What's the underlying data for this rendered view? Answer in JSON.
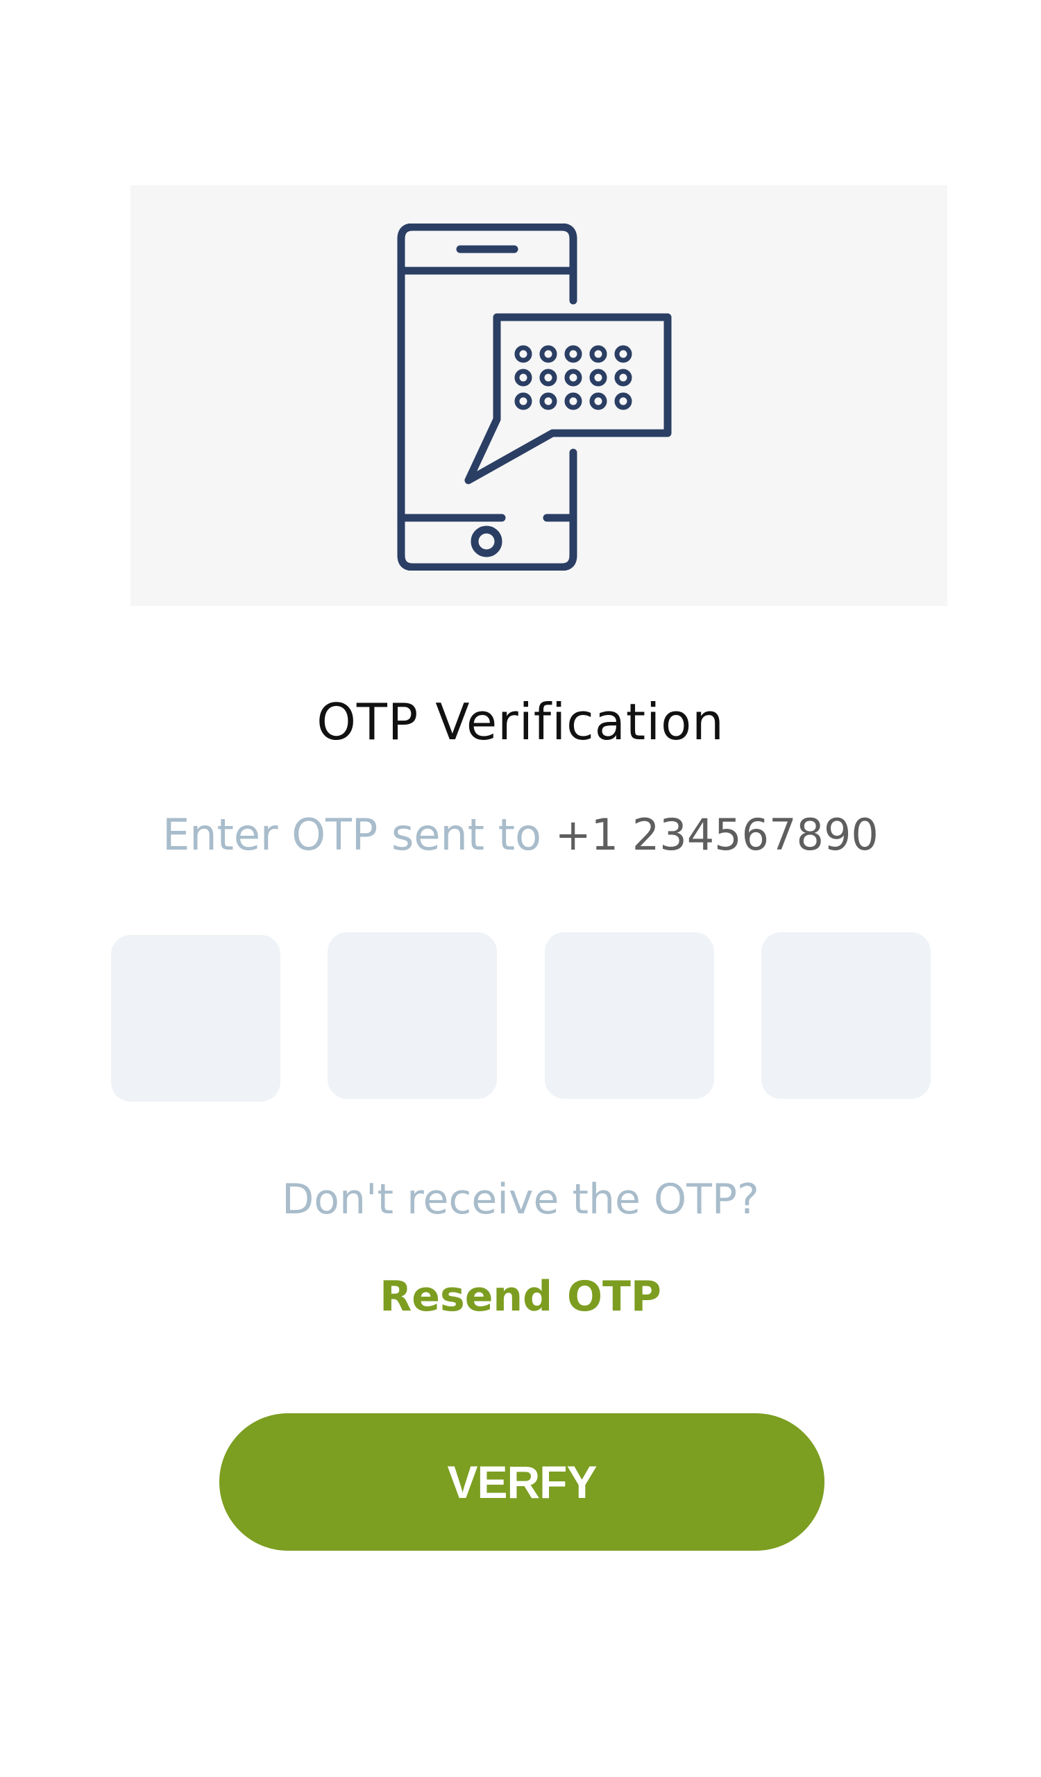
{
  "hero": {
    "icon": "phone-message-icon",
    "icon_color": "#2b3e63"
  },
  "title": "OTP Verification",
  "subtitle": {
    "prefix": "Enter OTP sent to",
    "phone": "+1 234567890"
  },
  "otp": {
    "digits": [
      "",
      "",
      "",
      ""
    ]
  },
  "no_otp_text": "Don't receive the OTP?",
  "resend_label": "Resend OTP",
  "verify_label": "VERFY",
  "colors": {
    "accent": "#7c9e21",
    "muted": "#a8bccb",
    "box": "#eff2f6"
  }
}
